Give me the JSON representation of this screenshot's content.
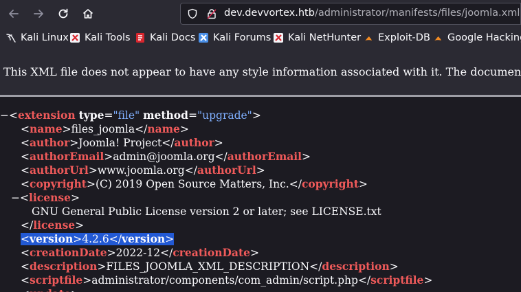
{
  "toolbar": {
    "url_domain": "dev.devvortex.htb",
    "url_path": "/administrator/manifests/files/joomla.xml"
  },
  "bookmarks": [
    {
      "label": "Kali Linux",
      "icon": "kali-linux-icon"
    },
    {
      "label": "Kali Tools",
      "icon": "kali-tools-icon"
    },
    {
      "label": "Kali Docs",
      "icon": "kali-docs-icon"
    },
    {
      "label": "Kali Forums",
      "icon": "kali-forums-icon"
    },
    {
      "label": "Kali NetHunter",
      "icon": "kali-nethunter-icon"
    },
    {
      "label": "Exploit-DB",
      "icon": "exploit-db-icon"
    },
    {
      "label": "Google Hacking",
      "icon": "google-hacking-icon"
    }
  ],
  "info_banner": "This XML file does not appear to have any style information associated with it. The document tree is shown below.",
  "xml": {
    "root_tag": "extension",
    "attr1_name": "type",
    "attr1_value": "\"file\"",
    "attr2_name": "method",
    "attr2_value": "\"upgrade\"",
    "elements": [
      {
        "tag": "name",
        "text": "files_joomla"
      },
      {
        "tag": "author",
        "text": "Joomla! Project"
      },
      {
        "tag": "authorEmail",
        "text": "admin@joomla.org"
      },
      {
        "tag": "authorUrl",
        "text": "www.joomla.org"
      },
      {
        "tag": "copyright",
        "text": "(C) 2019 Open Source Matters, Inc."
      }
    ],
    "license_tag": "license",
    "license_text": "GNU General Public License version 2 or later; see LICENSE.txt",
    "version_tag": "version",
    "version_text": "4.2.6",
    "elements2": [
      {
        "tag": "creationDate",
        "text": "2022-12"
      },
      {
        "tag": "description",
        "text": "FILES_JOOMLA_XML_DESCRIPTION"
      },
      {
        "tag": "scriptfile",
        "text": "administrator/components/com_admin/script.php"
      }
    ],
    "partial_tag": "update"
  },
  "colors": {
    "tag": "#ef5a5a",
    "attr_value": "#80b0ff",
    "highlight": "#2259d4"
  }
}
